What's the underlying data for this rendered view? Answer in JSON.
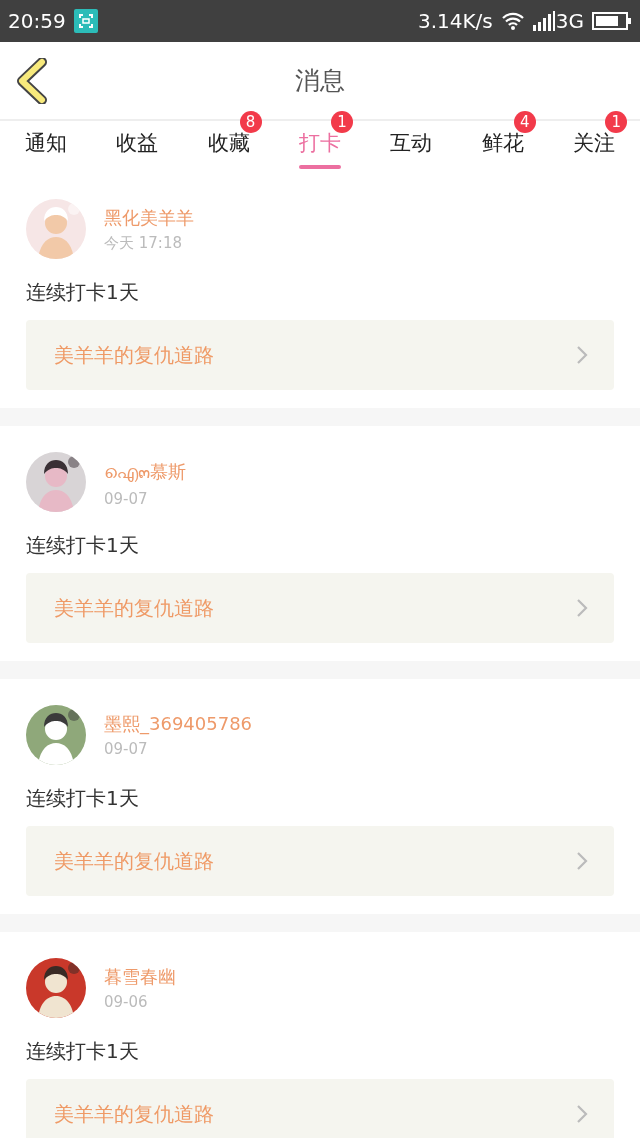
{
  "status_bar": {
    "time": "20:59",
    "speed": "3.14K/s",
    "network": "3G"
  },
  "header": {
    "title": "消息"
  },
  "tabs": [
    {
      "label": "通知",
      "selected": false
    },
    {
      "label": "收益",
      "selected": false
    },
    {
      "label": "收藏",
      "badge": "8",
      "selected": false
    },
    {
      "label": "打卡",
      "badge": "1",
      "selected": true
    },
    {
      "label": "互动",
      "selected": false
    },
    {
      "label": "鲜花",
      "badge": "4",
      "selected": false
    },
    {
      "label": "关注",
      "badge": "1",
      "selected": false
    }
  ],
  "messages": [
    {
      "name": "黑化美羊羊",
      "time": "今天 17:18",
      "text": "连续打卡1天",
      "link": "美羊羊的复仇道路"
    },
    {
      "name": "ഐ๓慕斯",
      "time": "09-07",
      "text": "连续打卡1天",
      "link": "美羊羊的复仇道路"
    },
    {
      "name": "墨熙_369405786",
      "time": "09-07",
      "text": "连续打卡1天",
      "link": "美羊羊的复仇道路"
    },
    {
      "name": "暮雪春幽",
      "time": "09-06",
      "text": "连续打卡1天",
      "link": "美羊羊的复仇道路"
    }
  ]
}
